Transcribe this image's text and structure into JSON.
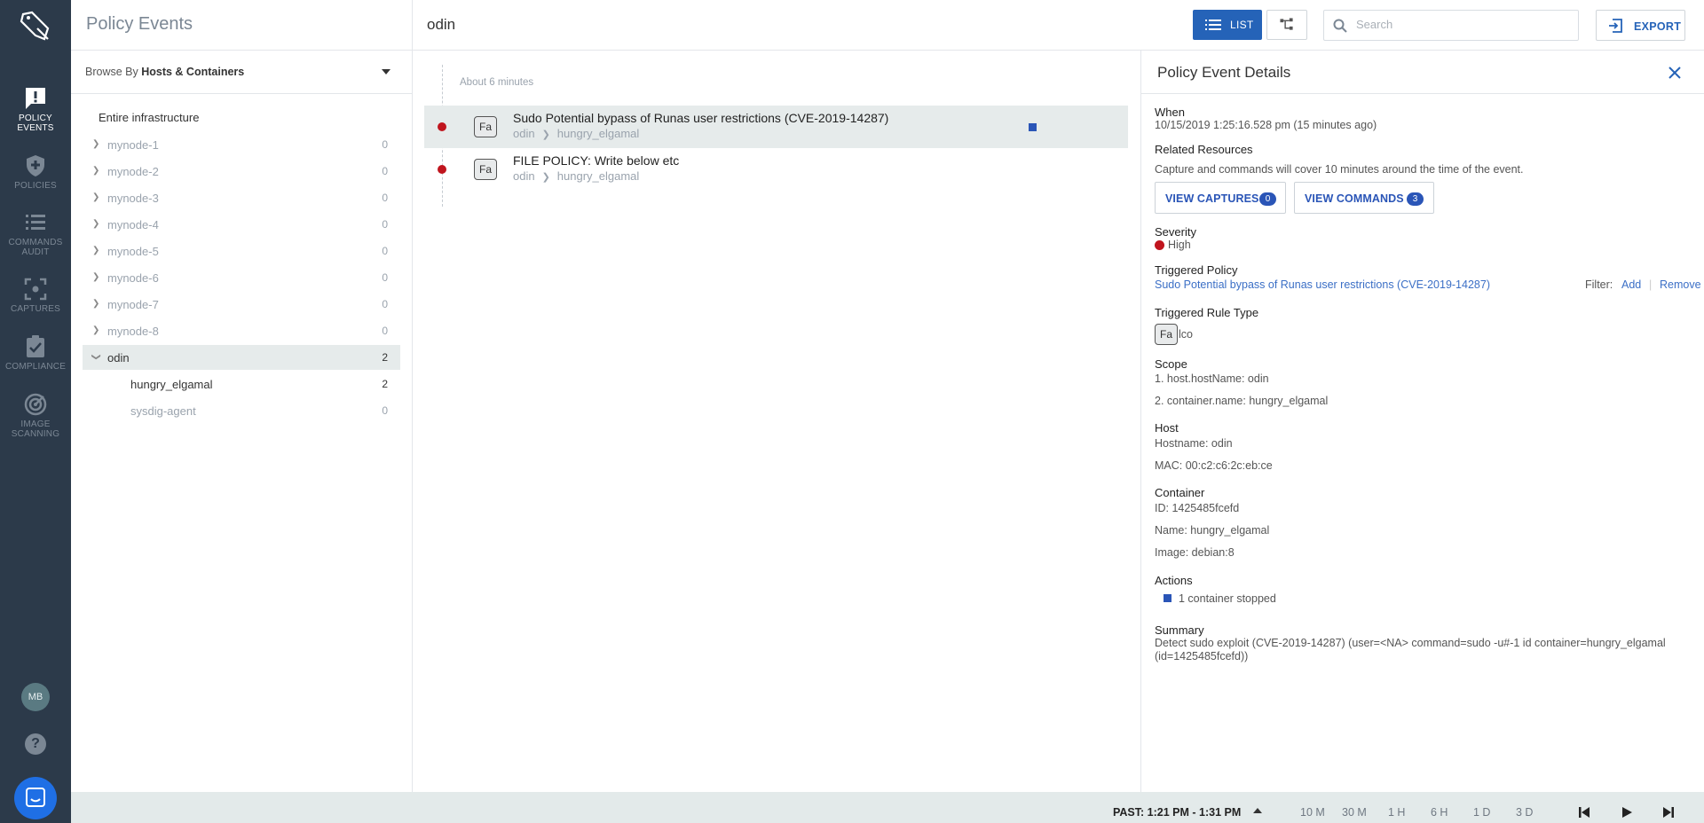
{
  "nav": {
    "items": [
      {
        "label": "POLICY EVENTS",
        "icon": "alert-message-icon"
      },
      {
        "label": "POLICIES",
        "icon": "shield-icon"
      },
      {
        "label": "COMMANDS AUDIT",
        "icon": "list-icon"
      },
      {
        "label": "CAPTURES",
        "icon": "capture-icon"
      },
      {
        "label": "COMPLIANCE",
        "icon": "clipboard-check-icon"
      },
      {
        "label": "IMAGE SCANNING",
        "icon": "scan-icon"
      }
    ],
    "avatar_initials": "MB"
  },
  "browse": {
    "title": "Policy Events",
    "browse_by_prefix": "Browse By",
    "browse_by_value": "Hosts & Containers",
    "root": "Entire infrastructure",
    "nodes": [
      {
        "label": "mynode-1",
        "count": "0"
      },
      {
        "label": "mynode-2",
        "count": "0"
      },
      {
        "label": "mynode-3",
        "count": "0"
      },
      {
        "label": "mynode-4",
        "count": "0"
      },
      {
        "label": "mynode-5",
        "count": "0"
      },
      {
        "label": "mynode-6",
        "count": "0"
      },
      {
        "label": "mynode-7",
        "count": "0"
      },
      {
        "label": "mynode-8",
        "count": "0"
      },
      {
        "label": "odin",
        "count": "2"
      }
    ],
    "children": [
      {
        "label": "hungry_elgamal",
        "count": "2"
      },
      {
        "label": "sysdig-agent",
        "count": "0"
      }
    ]
  },
  "topbar": {
    "title": "odin",
    "list_label": "LIST",
    "search_placeholder": "Search",
    "export_label": "EXPORT"
  },
  "events": {
    "time_label": "About 6 minutes",
    "items": [
      {
        "badge": "Fa",
        "title": "Sudo Potential bypass of Runas user restrictions (CVE-2019-14287)",
        "host": "odin",
        "container": "hungry_elgamal"
      },
      {
        "badge": "Fa",
        "title": "FILE POLICY: Write below etc",
        "host": "odin",
        "container": "hungry_elgamal"
      }
    ]
  },
  "details": {
    "title": "Policy Event Details",
    "when_label": "When",
    "when_value": "10/15/2019 1:25:16.528 pm (15 minutes ago)",
    "related_label": "Related Resources",
    "related_note": "Capture and commands will cover 10 minutes around the time of the event.",
    "view_captures_label": "VIEW CAPTURES",
    "view_captures_count": "0",
    "view_commands_label": "VIEW COMMANDS",
    "view_commands_count": "3",
    "severity_label": "Severity",
    "severity_value": "High",
    "triggered_policy_label": "Triggered Policy",
    "triggered_policy_value": "Sudo Potential bypass of Runas user restrictions (CVE-2019-14287)",
    "filter_label": "Filter:",
    "filter_add": "Add",
    "filter_remove": "Remove",
    "rule_type_label": "Triggered Rule Type",
    "rule_type_badge": "Fa",
    "rule_type_suffix": "lco",
    "scope_label": "Scope",
    "scope_1": "1. host.hostName: odin",
    "scope_2": "2. container.name: hungry_elgamal",
    "host_label": "Host",
    "hostname": "Hostname: odin",
    "mac": "MAC: 00:c2:c6:2c:eb:ce",
    "container_label": "Container",
    "container_id": "ID: 1425485fcefd",
    "container_name": "Name: hungry_elgamal",
    "container_image": "Image: debian:8",
    "actions_label": "Actions",
    "actions_value": "1 container stopped",
    "summary_label": "Summary",
    "summary_value": "Detect sudo exploit (CVE-2019-14287) (user=<NA> command=sudo -u#-1 id container=hungry_elgamal (id=1425485fcefd))"
  },
  "bottombar": {
    "past": "PAST: 1:21 PM - 1:31 PM",
    "ranges": [
      "10 M",
      "30 M",
      "1 H",
      "6 H",
      "1 D",
      "3 D"
    ]
  },
  "colors": {
    "nav_bg": "#2c3a4a",
    "accent": "#2563b8",
    "severity_high": "#c0151e",
    "selected_row": "#e6ebeb"
  }
}
